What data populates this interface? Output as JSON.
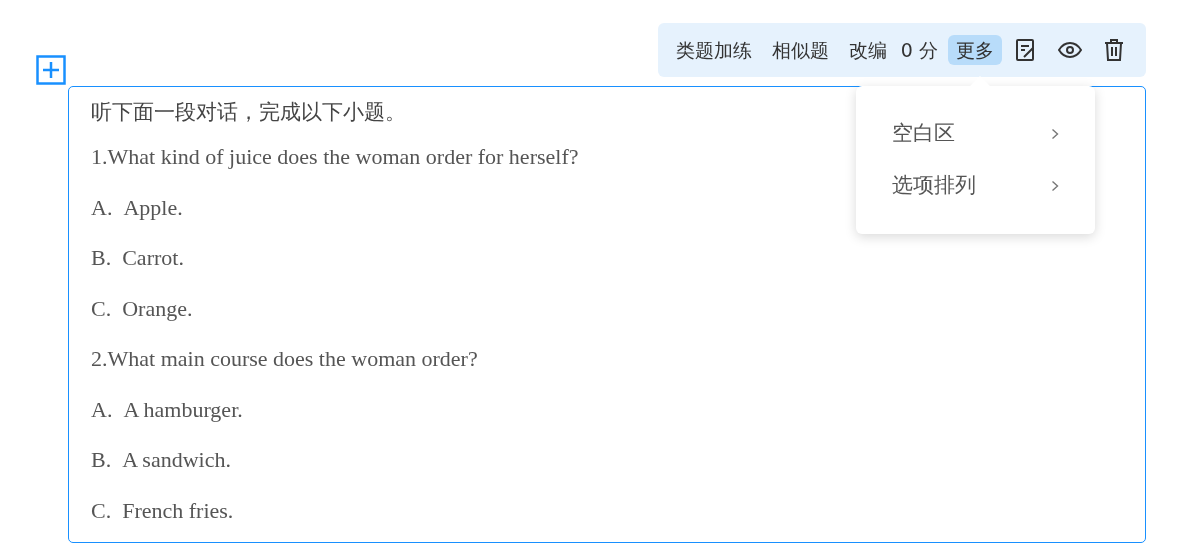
{
  "toolbar": {
    "items": [
      {
        "label": "类题加练",
        "kind": "link",
        "selected": false
      },
      {
        "label": "相似题",
        "kind": "link",
        "selected": false
      },
      {
        "label": "改编",
        "kind": "link",
        "selected": false
      },
      {
        "label": "0 分",
        "kind": "score",
        "selected": false
      },
      {
        "label": "更多",
        "kind": "link",
        "selected": true
      }
    ]
  },
  "menu": {
    "items": [
      {
        "label": "空白区"
      },
      {
        "label": "选项排列"
      }
    ]
  },
  "question": {
    "instruction": "听下面一段对话，完成以下小题。",
    "items": [
      {
        "stem": "1.What kind of juice does the woman order for herself?",
        "options": [
          {
            "letter": "A.",
            "text": "Apple."
          },
          {
            "letter": "B.",
            "text": "Carrot."
          },
          {
            "letter": "C.",
            "text": "Orange."
          }
        ]
      },
      {
        "stem": "2.What main course does the woman order?",
        "options": [
          {
            "letter": "A.",
            "text": "A hamburger."
          },
          {
            "letter": "B.",
            "text": "A sandwich."
          },
          {
            "letter": "C.",
            "text": "French fries."
          }
        ]
      }
    ]
  }
}
